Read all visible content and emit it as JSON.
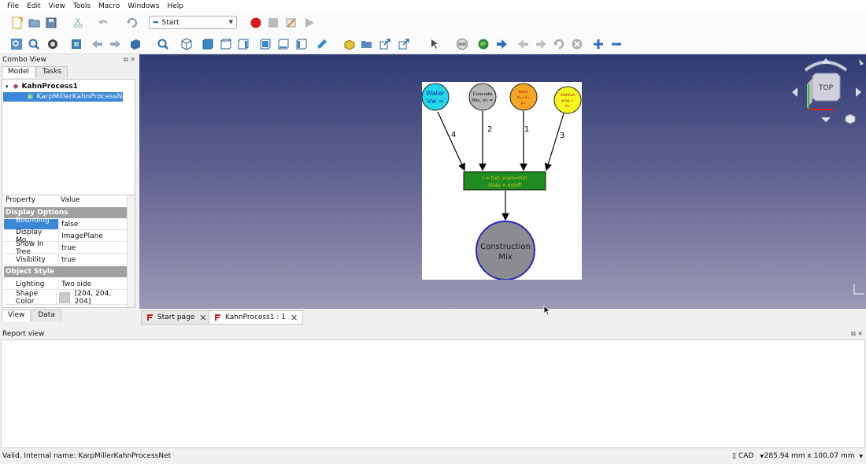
{
  "menu": [
    "File",
    "Edit",
    "View",
    "Tools",
    "Macro",
    "Windows",
    "Help"
  ],
  "workbench": {
    "selected": "Start"
  },
  "combo": {
    "title": "Combo View",
    "tabs": [
      "Model",
      "Tasks"
    ],
    "tree": {
      "root": "KahnProcess1",
      "child": "KarpMillerKahnProcessNet"
    }
  },
  "properties": {
    "header": [
      "Property",
      "Value"
    ],
    "groups": [
      {
        "name": "Display Options",
        "rows": [
          {
            "name": "Bounding ...",
            "value": "false"
          },
          {
            "name": "Display Mo...",
            "value": "ImagePlane"
          },
          {
            "name": "Show In Tree",
            "value": "true"
          },
          {
            "name": "Visibility",
            "value": "true"
          }
        ]
      },
      {
        "name": "Object Style",
        "rows": [
          {
            "name": "Lighting",
            "value": "Two side"
          },
          {
            "name": "Shape Color",
            "value": "[204, 204, 204]"
          }
        ]
      }
    ],
    "bottom_tabs": [
      "View",
      "Data"
    ]
  },
  "diagram": {
    "nodes": [
      {
        "label1": "Water",
        "label2": "Vw =",
        "color": "#22d8e8"
      },
      {
        "label1": "Concrete",
        "label2": "Mix, Vc =",
        "color": "#b8b8b8"
      },
      {
        "label1": "Sand,",
        "label2": "d=, V=",
        "label3": "p=",
        "color": "#f5a623"
      },
      {
        "label1": "Additive",
        "label2": "prop =",
        "label3": "V=",
        "color": "#f5f520"
      }
    ],
    "edge_labels": [
      "4",
      "2",
      "1",
      "3"
    ],
    "process": {
      "line1": "t = f(V), vrpm=f(V)",
      "line2": "State = on/off",
      "color": "#1f8c1f"
    },
    "output": {
      "line1": "Construction",
      "line2": "Mix",
      "color": "#8c8c90"
    }
  },
  "navcube": {
    "face": "TOP"
  },
  "doc_tabs": [
    "Start page",
    "KahnProcess1 : 1"
  ],
  "report": {
    "title": "Report view"
  },
  "status": {
    "message": "Valid, Internal name: KarpMillerKahnProcessNet",
    "nav_style": "CAD",
    "dimensions": "285.94 mm x 100.07 mm"
  }
}
